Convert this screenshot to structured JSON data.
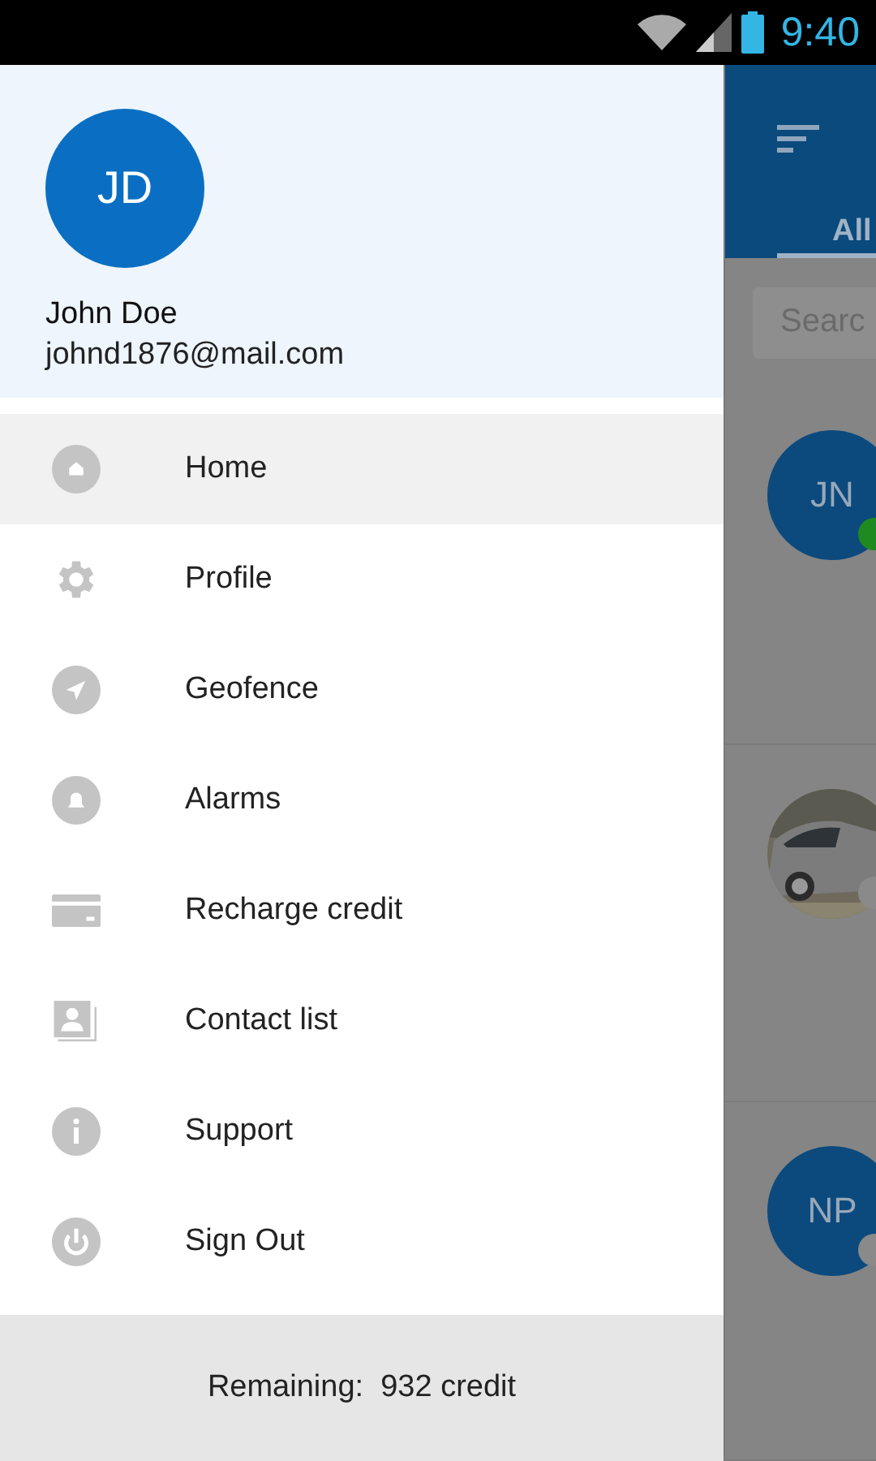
{
  "status_bar": {
    "time": "9:40"
  },
  "drawer": {
    "user": {
      "initials": "JD",
      "name": "John Doe",
      "email": "johnd1876@mail.com"
    },
    "items": [
      {
        "label": "Home",
        "kind": "home",
        "selected": true
      },
      {
        "label": "Profile",
        "kind": "gear",
        "selected": false
      },
      {
        "label": "Geofence",
        "kind": "navigation",
        "selected": false
      },
      {
        "label": "Alarms",
        "kind": "bell",
        "selected": false
      },
      {
        "label": "Recharge credit",
        "kind": "card",
        "selected": false
      },
      {
        "label": "Contact list",
        "kind": "contacts",
        "selected": false
      },
      {
        "label": "Support",
        "kind": "info",
        "selected": false
      },
      {
        "label": "Sign Out",
        "kind": "power",
        "selected": false
      }
    ],
    "footer": "Remaining:  932 credit"
  },
  "background": {
    "tab": "All",
    "search": {
      "placeholder": "Searc"
    },
    "contacts": [
      {
        "kind": "initials",
        "initials": "JN",
        "color": "#1f8a1f"
      },
      {
        "kind": "picture",
        "color": "#8a8a8a"
      },
      {
        "kind": "initials",
        "initials": "NP",
        "color": "#8a8a8a"
      }
    ]
  }
}
